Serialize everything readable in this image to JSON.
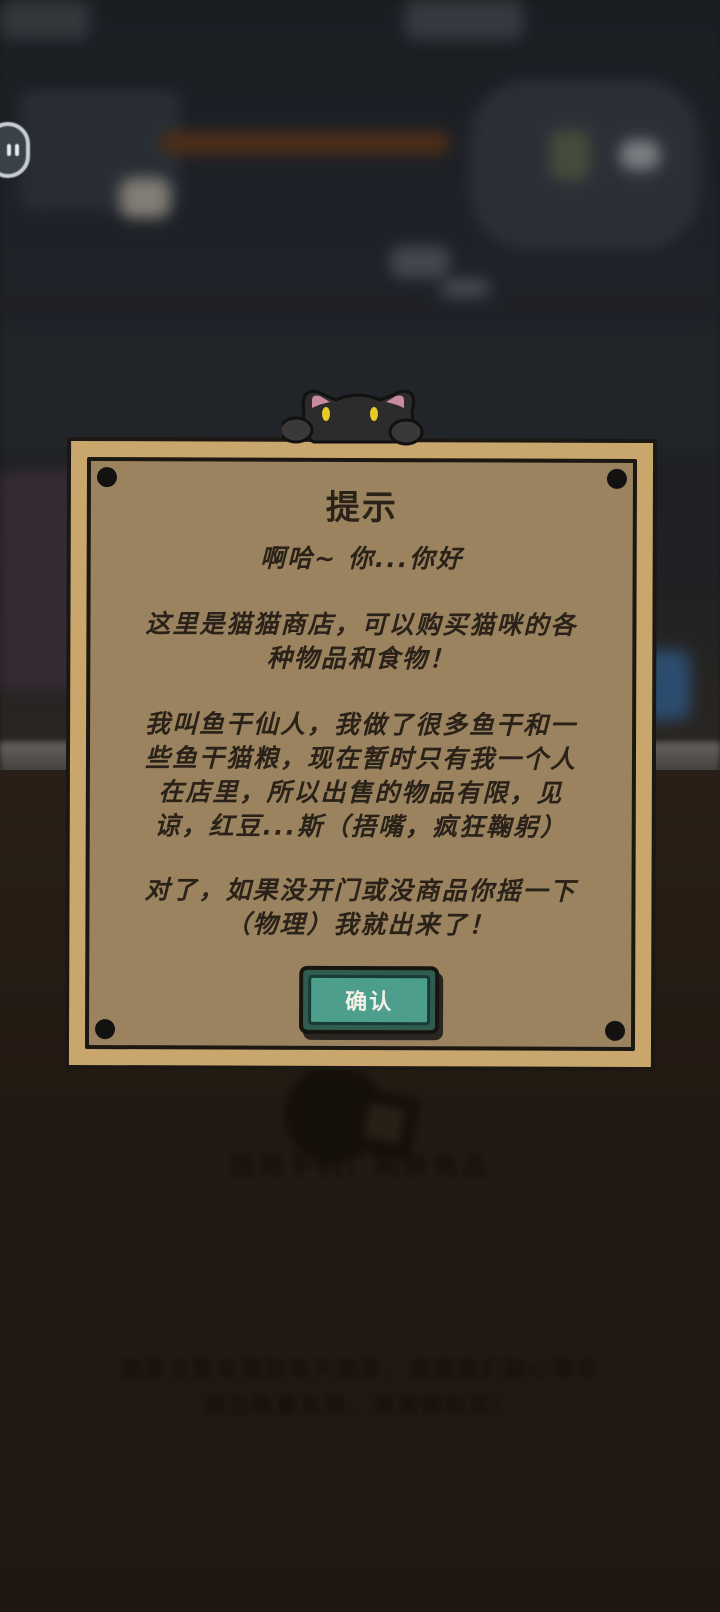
{
  "dialog": {
    "title": "提示",
    "greeting": "啊哈~ 你...你好",
    "paragraph1_line1": "这里是猫猫商店，可以购买猫咪的各",
    "paragraph1_line2": "种物品和食物！",
    "paragraph2_line1": "我叫鱼干仙人，我做了很多鱼干和一",
    "paragraph2_line2": "些鱼干猫粮，现在暂时只有我一个人",
    "paragraph2_line3": "在店里，所以出售的物品有限，见",
    "paragraph2_line4": "谅，红豆...斯（捂嘴，疯狂鞠躬）",
    "paragraph3_line1": "对了，如果没开门或没商品你摇一下",
    "paragraph3_line2": "（物理）我就出来了！",
    "confirm_label": "确认"
  },
  "background": {
    "caption": "摇晃手机，刷新商品",
    "notice_line1": "刷新次数有限制每天刷新，请猫猫们耐心等待",
    "notice_line2": "商品数量有限，请谨慎购买！"
  },
  "icons": {
    "pause": "pause-icon",
    "cat": "cat-peek-icon",
    "shop": "shop-icon"
  },
  "colors": {
    "frame": "#c9a66b",
    "board": "#9a835e",
    "button": "#4d9e8d",
    "text": "#2a2219"
  }
}
